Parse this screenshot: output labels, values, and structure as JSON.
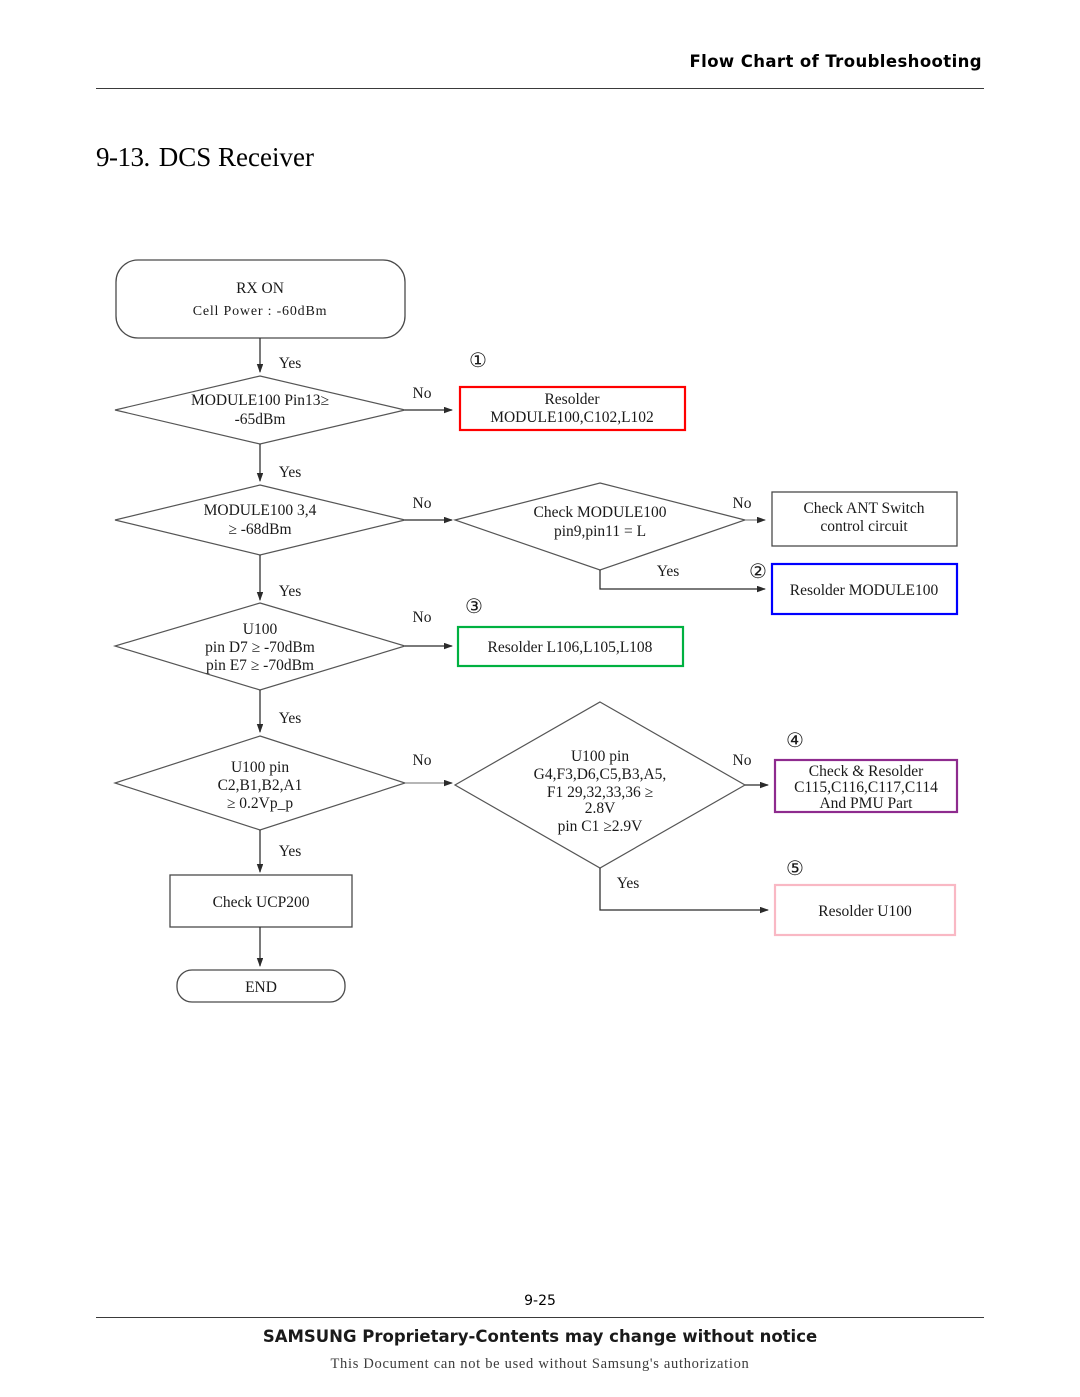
{
  "header": {
    "title": "Flow Chart of Troubleshooting"
  },
  "section": {
    "number": "9-13.",
    "title": "DCS Receiver"
  },
  "footer": {
    "page_number": "9-25",
    "proprietary": "SAMSUNG Proprietary-Contents may change without notice",
    "authorization": "This Document can not be used without Samsung's authorization"
  },
  "colors": {
    "marker1": "#ff0000",
    "marker2": "#0000ff",
    "marker3": "#00b140",
    "marker4": "#8e2b8e",
    "marker5": "#f9b8c4",
    "default_box": "#4a4a4a"
  },
  "chart_data": {
    "type": "diagram",
    "title": "DCS Receiver Troubleshooting Flow Chart",
    "start": {
      "id": "start",
      "shape": "rounded",
      "line1": "RX ON",
      "line2": "Cell Power : -60dBm"
    },
    "decisions": [
      {
        "id": "d1",
        "shape": "diamond",
        "lines": [
          "MODULE100 Pin13≥",
          "-65dBm"
        ],
        "yes": "down",
        "no": "right"
      },
      {
        "id": "d2",
        "shape": "diamond",
        "lines": [
          "MODULE100 3,4",
          "≥ -68dBm"
        ],
        "yes": "down",
        "no": "right"
      },
      {
        "id": "d2b",
        "shape": "diamond",
        "lines": [
          "Check MODULE100",
          "pin9,pin11 = L"
        ],
        "yes": "down",
        "no": "right"
      },
      {
        "id": "d3",
        "shape": "diamond",
        "lines": [
          "U100",
          "pin D7 ≥ -70dBm",
          "pin E7 ≥ -70dBm"
        ],
        "yes": "down",
        "no": "right"
      },
      {
        "id": "d4",
        "shape": "diamond",
        "lines": [
          "U100 pin",
          "C2,B1,B2,A1",
          "≥ 0.2Vp_p"
        ],
        "yes": "down",
        "no": "right"
      },
      {
        "id": "d4b",
        "shape": "diamond",
        "lines": [
          "U100 pin",
          "G4,F3,D6,C5,B3,A5,",
          "F1 29,32,33,36 ≥",
          "2.8V",
          "pin C1 ≥2.9V"
        ],
        "yes": "down",
        "no": "right"
      }
    ],
    "actions": [
      {
        "id": "a1",
        "marker": "①",
        "marker_color": "#ff0000",
        "border_color": "#ff0000",
        "lines": [
          "Resolder",
          "MODULE100,C102,L102"
        ]
      },
      {
        "id": "ant",
        "marker": "",
        "marker_color": "",
        "border_color": "#4a4a4a",
        "lines": [
          "Check ANT Switch",
          "control circuit"
        ]
      },
      {
        "id": "a2",
        "marker": "②",
        "marker_color": "#0000ff",
        "border_color": "#0000ff",
        "lines": [
          "Resolder MODULE100"
        ]
      },
      {
        "id": "a3",
        "marker": "③",
        "marker_color": "#00b140",
        "border_color": "#00b140",
        "lines": [
          "Resolder L106,L105,L108"
        ]
      },
      {
        "id": "a4",
        "marker": "④",
        "marker_color": "#8e2b8e",
        "border_color": "#8e2b8e",
        "lines": [
          "Check & Resolder",
          "C115,C116,C117,C114",
          "And PMU Part"
        ]
      },
      {
        "id": "a5",
        "marker": "⑤",
        "marker_color": "#f9b8c4",
        "border_color": "#f9b8c4",
        "lines": [
          "Resolder U100"
        ]
      },
      {
        "id": "ucp",
        "marker": "",
        "marker_color": "",
        "border_color": "#4a4a4a",
        "lines": [
          "Check UCP200"
        ]
      }
    ],
    "end": {
      "id": "end",
      "shape": "rounded",
      "label": "END"
    },
    "edge_labels": {
      "yes": "Yes",
      "no": "No"
    }
  }
}
